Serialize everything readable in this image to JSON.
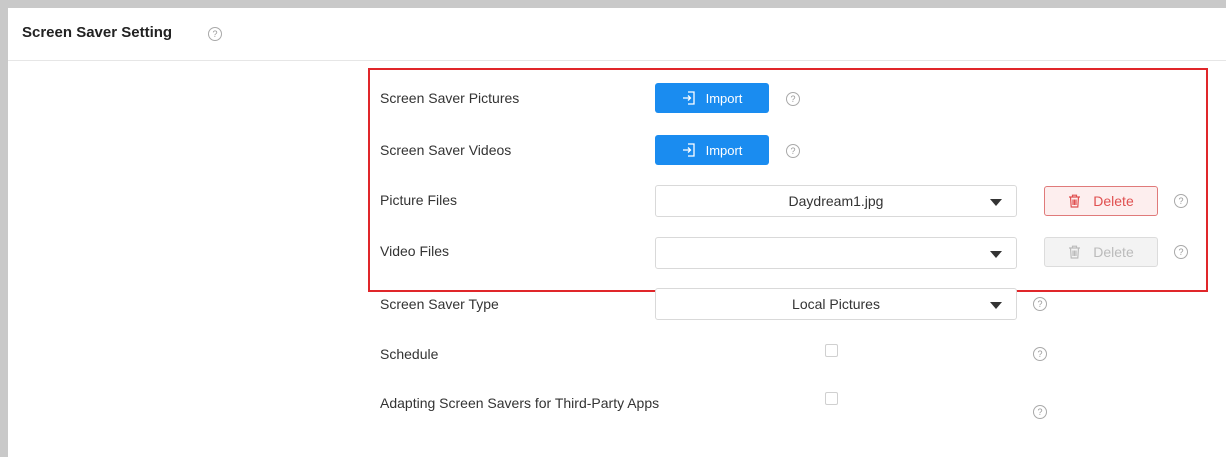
{
  "panel": {
    "title": "Screen Saver Setting",
    "help_symbol": "?"
  },
  "rows": {
    "pictures": {
      "label": "Screen Saver Pictures",
      "button": "Import"
    },
    "videos": {
      "label": "Screen Saver Videos",
      "button": "Import"
    },
    "picture_files": {
      "label": "Picture Files",
      "selected": "Daydream1.jpg",
      "delete": "Delete"
    },
    "video_files": {
      "label": "Video Files",
      "selected": "",
      "delete": "Delete"
    },
    "type": {
      "label": "Screen Saver Type",
      "selected": "Local Pictures"
    },
    "schedule": {
      "label": "Schedule",
      "checked": false
    },
    "third_party": {
      "label": "Adapting Screen Savers for Third-Party Apps",
      "checked": false
    }
  },
  "icons": {
    "import": "import-icon",
    "delete": "trash-icon",
    "dropdown": "chevron-down-icon",
    "help": "help-icon"
  },
  "colors": {
    "primary": "#1a8cf0",
    "danger": "#e05050",
    "highlight": "#e0262a"
  }
}
